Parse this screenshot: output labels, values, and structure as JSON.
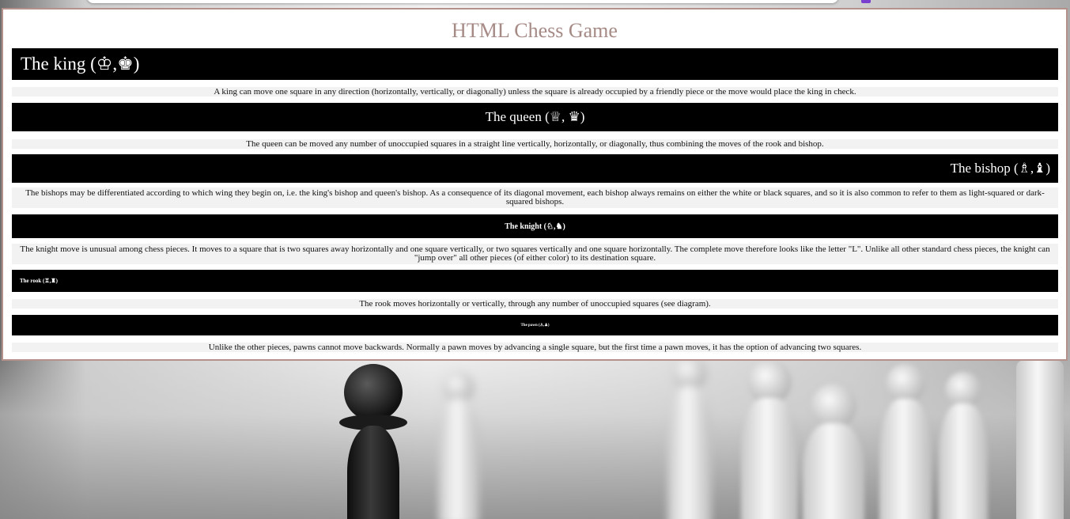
{
  "page": {
    "title": "HTML Chess Game"
  },
  "sections": [
    {
      "heading": "The king (♔,♚)",
      "text": "A king can move one square in any direction (horizontally, vertically, or diagonally) unless the square is already occupied by a friendly piece or the move would place the king in check."
    },
    {
      "heading": "The queen (♕, ♛)",
      "text": "The queen can be moved any number of unoccupied squares in a straight line vertically, horizontally, or diagonally, thus combining the moves of the rook and bishop."
    },
    {
      "heading": "The bishop (♗,♝)",
      "text": "The bishops may be differentiated according to which wing they begin on, i.e. the king's bishop and queen's bishop. As a consequence of its diagonal movement, each bishop always remains on either the white or black squares, and so it is also common to refer to them as light-squared or dark-squared bishops."
    },
    {
      "heading": "The knight (♘,♞)",
      "text": "The knight move is unusual among chess pieces. It moves to a square that is two squares away horizontally and one square vertically, or two squares vertically and one square horizontally. The complete move therefore looks like the letter \"L\". Unlike all other standard chess pieces, the knight can \"jump over\" all other pieces (of either color) to its destination square."
    },
    {
      "heading": "The rook (♖,♜)",
      "text": "The rook moves horizontally or vertically, through any number of unoccupied squares (see diagram)."
    },
    {
      "heading": "The pawn (♙,♟)",
      "text": "Unlike the other pieces, pawns cannot move backwards. Normally a pawn moves by advancing a single square, but the first time a pawn moves, it has the option of advancing two squares."
    }
  ],
  "colors": {
    "title": "#a58a85",
    "panel_border": "#b5918c",
    "heading_bg": "#000000",
    "heading_text": "#ffffff",
    "body_bg": "#f2f2f2"
  }
}
